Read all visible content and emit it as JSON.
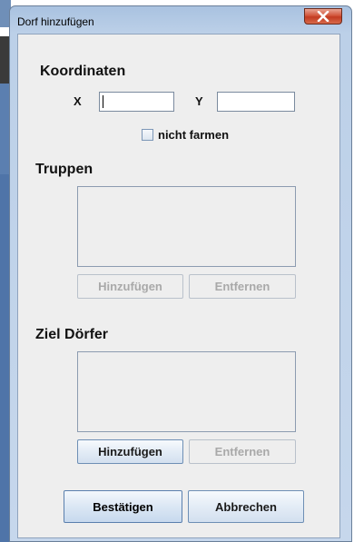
{
  "window": {
    "title": "Dorf hinzufügen"
  },
  "koordinaten": {
    "heading": "Koordinaten",
    "x_label": "X",
    "x_value": "",
    "y_label": "Y",
    "y_value": "",
    "nicht_farmen_label": "nicht farmen",
    "nicht_farmen_checked": false
  },
  "truppen": {
    "heading": "Truppen",
    "items": [],
    "add_label": "Hinzufügen",
    "remove_label": "Entfernen"
  },
  "ziel_doerfer": {
    "heading": "Ziel Dörfer",
    "items": [],
    "add_label": "Hinzufügen",
    "remove_label": "Entfernen"
  },
  "footer": {
    "confirm_label": "Bestätigen",
    "cancel_label": "Abbrechen"
  },
  "icons": {
    "close": "close-icon"
  }
}
